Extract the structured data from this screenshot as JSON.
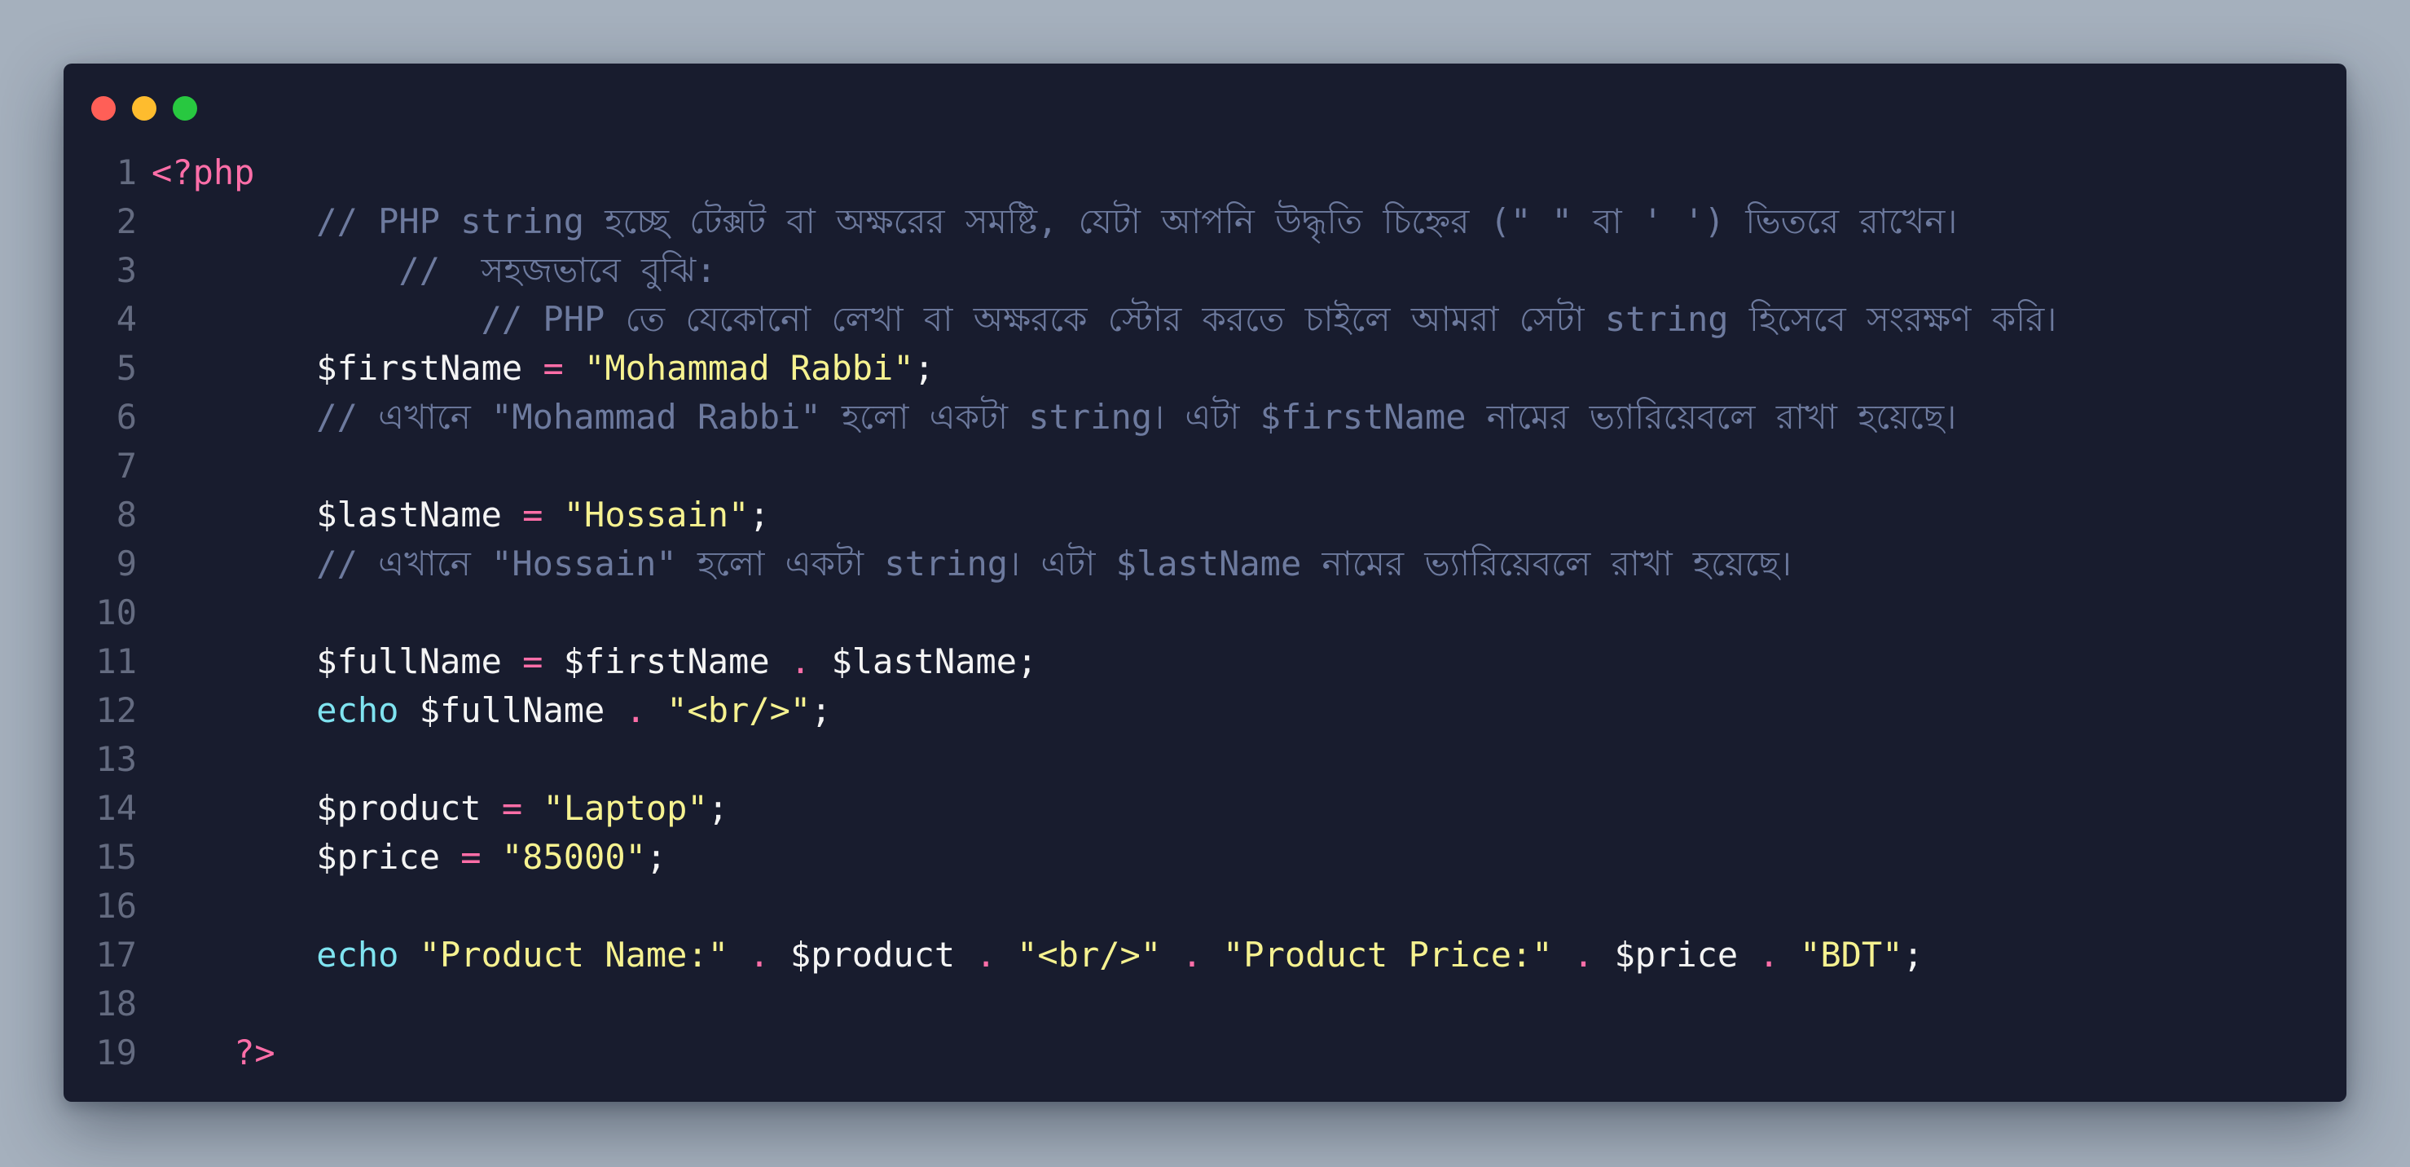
{
  "window": {
    "controls": {
      "close": "#ff5f57",
      "minimize": "#febc2e",
      "maximize": "#28c840"
    }
  },
  "colors": {
    "background": "#a5b0bd",
    "editor": "#181c2e",
    "comment": "#6d7a9e",
    "string": "#f6f290",
    "operator": "#ff6ea8",
    "keyword": "#7fe3f0",
    "text": "#f4f4f4",
    "line_number": "#646b80"
  },
  "code": {
    "lines": [
      {
        "n": "1",
        "tokens": [
          {
            "t": "<?php",
            "c": "tag"
          }
        ]
      },
      {
        "n": "2",
        "tokens": [
          {
            "t": "        // PHP string হচ্ছে টেক্সট বা অক্ষরের সমষ্টি, যেটা আপনি উদ্ধৃতি চিহ্নের (\" \" বা ' ') ভিতরে রাখেন।",
            "c": "comment"
          }
        ]
      },
      {
        "n": "3",
        "tokens": [
          {
            "t": "            //  সহজভাবে বুঝি:",
            "c": "comment"
          }
        ]
      },
      {
        "n": "4",
        "tokens": [
          {
            "t": "                // PHP তে যেকোনো লেখা বা অক্ষরকে স্টোর করতে চাইলে আমরা সেটা string হিসেবে সংরক্ষণ করি।",
            "c": "comment"
          }
        ]
      },
      {
        "n": "5",
        "tokens": [
          {
            "t": "        $firstName ",
            "c": "plain"
          },
          {
            "t": "=",
            "c": "op"
          },
          {
            "t": " ",
            "c": "plain"
          },
          {
            "t": "\"Mohammad Rabbi\"",
            "c": "string"
          },
          {
            "t": ";",
            "c": "plain"
          }
        ]
      },
      {
        "n": "6",
        "tokens": [
          {
            "t": "        // এখানে \"Mohammad Rabbi\" হলো একটা string। এটা $firstName নামের ভ্যারিয়েবলে রাখা হয়েছে।",
            "c": "comment"
          }
        ]
      },
      {
        "n": "7",
        "tokens": []
      },
      {
        "n": "8",
        "tokens": [
          {
            "t": "        $lastName ",
            "c": "plain"
          },
          {
            "t": "=",
            "c": "op"
          },
          {
            "t": " ",
            "c": "plain"
          },
          {
            "t": "\"Hossain\"",
            "c": "string"
          },
          {
            "t": ";",
            "c": "plain"
          }
        ]
      },
      {
        "n": "9",
        "tokens": [
          {
            "t": "        // এখানে \"Hossain\" হলো একটা string। এটা $lastName নামের ভ্যারিয়েবলে রাখা হয়েছে।",
            "c": "comment"
          }
        ]
      },
      {
        "n": "10",
        "tokens": []
      },
      {
        "n": "11",
        "tokens": [
          {
            "t": "        $fullName ",
            "c": "plain"
          },
          {
            "t": "=",
            "c": "op"
          },
          {
            "t": " $firstName ",
            "c": "plain"
          },
          {
            "t": ".",
            "c": "op"
          },
          {
            "t": " $lastName;",
            "c": "plain"
          }
        ]
      },
      {
        "n": "12",
        "tokens": [
          {
            "t": "        ",
            "c": "plain"
          },
          {
            "t": "echo",
            "c": "kw"
          },
          {
            "t": " $fullName ",
            "c": "plain"
          },
          {
            "t": ".",
            "c": "op"
          },
          {
            "t": " ",
            "c": "plain"
          },
          {
            "t": "\"<br/>\"",
            "c": "string"
          },
          {
            "t": ";",
            "c": "plain"
          }
        ]
      },
      {
        "n": "13",
        "tokens": []
      },
      {
        "n": "14",
        "tokens": [
          {
            "t": "        $product ",
            "c": "plain"
          },
          {
            "t": "=",
            "c": "op"
          },
          {
            "t": " ",
            "c": "plain"
          },
          {
            "t": "\"Laptop\"",
            "c": "string"
          },
          {
            "t": ";",
            "c": "plain"
          }
        ]
      },
      {
        "n": "15",
        "tokens": [
          {
            "t": "        $price ",
            "c": "plain"
          },
          {
            "t": "=",
            "c": "op"
          },
          {
            "t": " ",
            "c": "plain"
          },
          {
            "t": "\"85000\"",
            "c": "string"
          },
          {
            "t": ";",
            "c": "plain"
          }
        ]
      },
      {
        "n": "16",
        "tokens": []
      },
      {
        "n": "17",
        "tokens": [
          {
            "t": "        ",
            "c": "plain"
          },
          {
            "t": "echo",
            "c": "kw"
          },
          {
            "t": " ",
            "c": "plain"
          },
          {
            "t": "\"Product Name:\"",
            "c": "string"
          },
          {
            "t": " ",
            "c": "plain"
          },
          {
            "t": ".",
            "c": "op"
          },
          {
            "t": " $product ",
            "c": "plain"
          },
          {
            "t": ".",
            "c": "op"
          },
          {
            "t": " ",
            "c": "plain"
          },
          {
            "t": "\"<br/>\"",
            "c": "string"
          },
          {
            "t": " ",
            "c": "plain"
          },
          {
            "t": ".",
            "c": "op"
          },
          {
            "t": " ",
            "c": "plain"
          },
          {
            "t": "\"Product Price:\"",
            "c": "string"
          },
          {
            "t": " ",
            "c": "plain"
          },
          {
            "t": ".",
            "c": "op"
          },
          {
            "t": " $price ",
            "c": "plain"
          },
          {
            "t": ".",
            "c": "op"
          },
          {
            "t": " ",
            "c": "plain"
          },
          {
            "t": "\"BDT\"",
            "c": "string"
          },
          {
            "t": ";",
            "c": "plain"
          }
        ]
      },
      {
        "n": "18",
        "tokens": []
      },
      {
        "n": "19",
        "tokens": [
          {
            "t": "    ?>",
            "c": "tag"
          }
        ]
      }
    ]
  }
}
